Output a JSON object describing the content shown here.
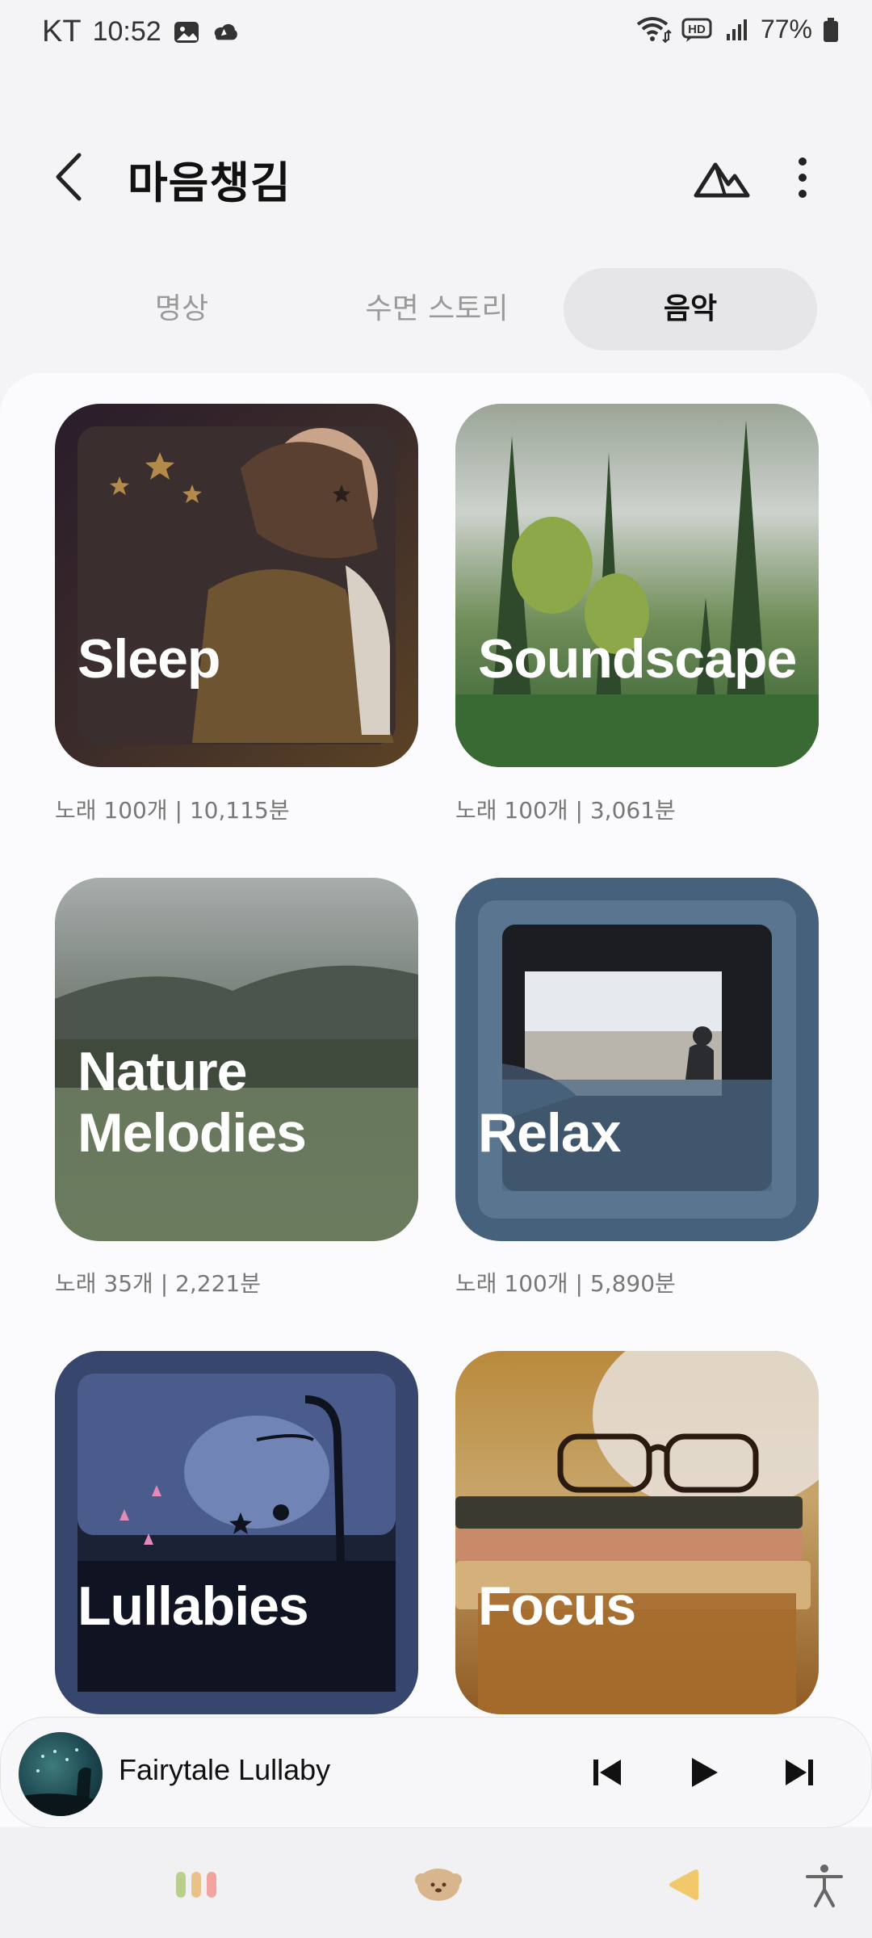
{
  "status_bar": {
    "carrier": "KT",
    "time": "10:52",
    "battery": "77%"
  },
  "header": {
    "title": "마음챙김"
  },
  "tabs": [
    {
      "label": "명상",
      "active": false
    },
    {
      "label": "수면 스토리",
      "active": false
    },
    {
      "label": "음악",
      "active": true
    }
  ],
  "cards": [
    {
      "title": "Sleep",
      "meta": "노래 100개 | 10,115분"
    },
    {
      "title": "Soundscape",
      "meta": "노래 100개 | 3,061분"
    },
    {
      "title": "Nature Melodies",
      "title_line1": "Nature",
      "title_line2": "Melodies",
      "meta": "노래 35개 | 2,221분"
    },
    {
      "title": "Relax",
      "meta": "노래 100개 | 5,890분"
    },
    {
      "title": "Lullabies"
    },
    {
      "title": "Focus"
    }
  ],
  "player": {
    "track_title": "Fairytale Lullaby"
  },
  "colors": {
    "background": "#f4f4f6",
    "tab_active_bg": "#e6e6e9",
    "sleep_card": "#3a2a2a",
    "soundscape_card": "#3d6b3a",
    "nature_card": "#5a6a55",
    "relax_card": "#46617b",
    "lullabies_card": "#2f3c66",
    "focus_card": "#a8702a"
  }
}
